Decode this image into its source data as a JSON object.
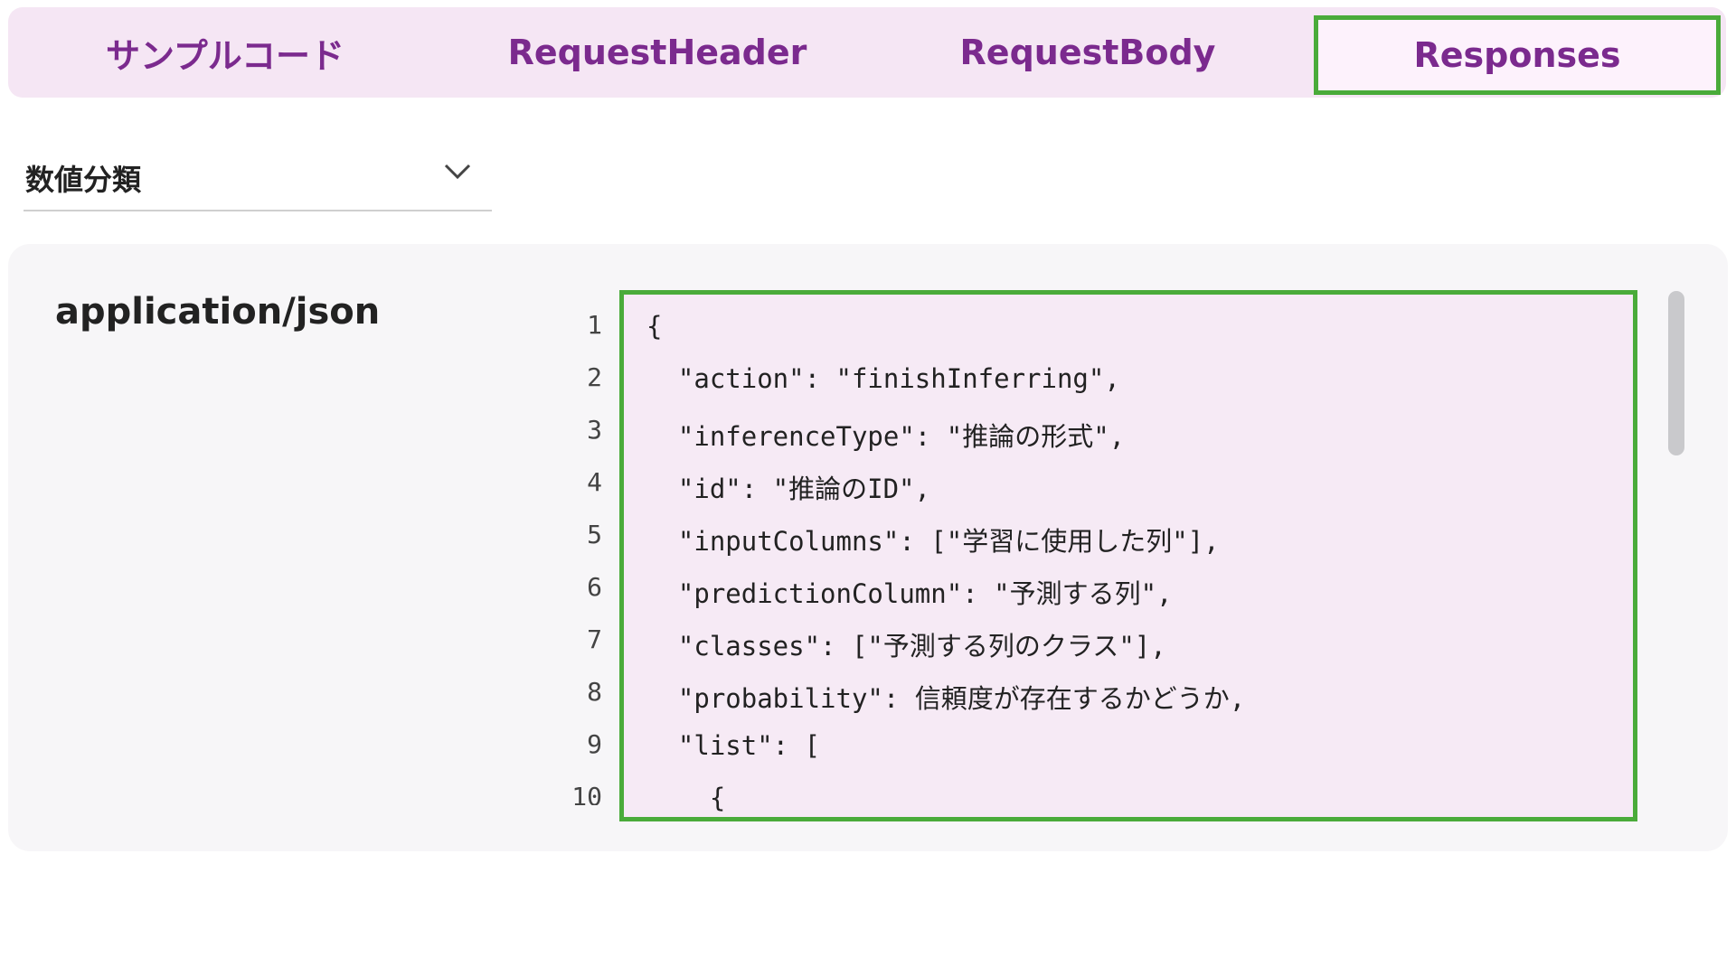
{
  "tabs": [
    {
      "label": "サンプルコード"
    },
    {
      "label": "RequestHeader"
    },
    {
      "label": "RequestBody"
    },
    {
      "label": "Responses"
    }
  ],
  "dropdown": {
    "value": "数値分類"
  },
  "response": {
    "media_type": "application/json"
  },
  "editor": {
    "line_numbers": [
      "1",
      "2",
      "3",
      "4",
      "5",
      "6",
      "7",
      "8",
      "9",
      "10"
    ],
    "lines": [
      "{",
      "  \"action\": \"finishInferring\",",
      "  \"inferenceType\": \"推論の形式\",",
      "  \"id\": \"推論のID\",",
      "  \"inputColumns\": [\"学習に使用した列\"],",
      "  \"predictionColumn\": \"予測する列\",",
      "  \"classes\": [\"予測する列のクラス\"],",
      "  \"probability\": 信頼度が存在するかどうか,",
      "  \"list\": [",
      "    {"
    ]
  },
  "colors": {
    "accent": "#7b2a8e",
    "highlight": "#4aab3a",
    "tabbar_bg": "#f5e6f4"
  }
}
